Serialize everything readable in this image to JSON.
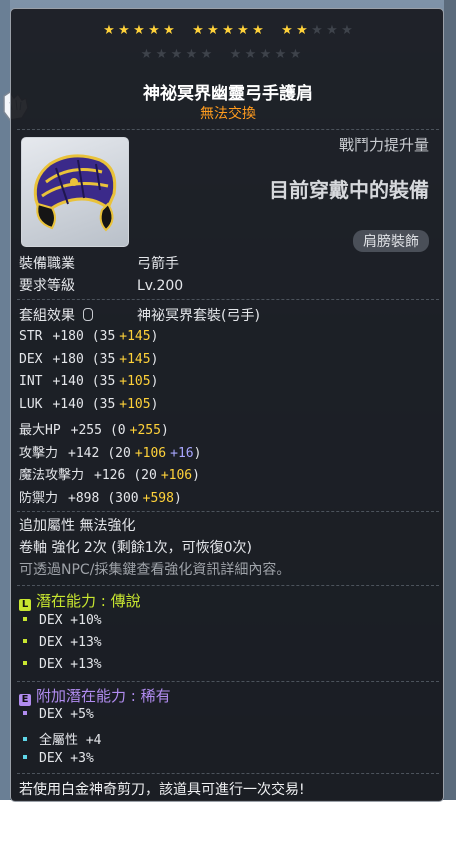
{
  "stars": {
    "filled": 12,
    "total": 15
  },
  "item": {
    "name": "神祕冥界幽靈弓手護肩",
    "trade_status": "無法交換",
    "combat_label": "戰鬥力提升量",
    "wearing_label": "目前穿戴中的裝備",
    "category_badge": "肩膀裝飾",
    "job_label": "裝備職業",
    "job_value": "弓箭手",
    "level_label": "要求等級",
    "level_value": "Lv.200",
    "set_label": "套組效果",
    "set_value": "神祕冥界套裝(弓手)"
  },
  "stats": [
    {
      "label": "STR",
      "total": "+180",
      "base": "(35",
      "bonus": "+145",
      "extra": "",
      "close": ")"
    },
    {
      "label": "DEX",
      "total": "+180",
      "base": "(35",
      "bonus": "+145",
      "extra": "",
      "close": ")"
    },
    {
      "label": "INT",
      "total": "+140",
      "base": "(35",
      "bonus": "+105",
      "extra": "",
      "close": ")"
    },
    {
      "label": "LUK",
      "total": "+140",
      "base": "(35",
      "bonus": "+105",
      "extra": "",
      "close": ")"
    },
    {
      "label": "最大HP",
      "total": "+255",
      "base": "(0",
      "bonus": "+255",
      "extra": "",
      "close": ")"
    },
    {
      "label": "攻擊力",
      "total": "+142",
      "base": "(20",
      "bonus": "+106",
      "extra": "+16",
      "close": ")"
    },
    {
      "label": "魔法攻擊力",
      "total": "+126",
      "base": "(20",
      "bonus": "+106",
      "extra": "",
      "close": ")"
    },
    {
      "label": "防禦力",
      "total": "+898",
      "base": "(300",
      "bonus": "+598",
      "extra": "",
      "close": ")"
    }
  ],
  "enhance": {
    "extra_attr": "追加屬性 無法強化",
    "scroll": "卷軸 強化 2次 (剩餘1次，可恢復0次)",
    "hint": "可透過NPC/採集鍵查看強化資訊詳細內容。"
  },
  "potential": {
    "badge": "L",
    "title": "潛在能力 : 傳說",
    "color": "#c8e630",
    "lines": [
      "DEX +10%",
      "DEX +13%",
      "DEX +13%"
    ]
  },
  "additional": {
    "badge": "E",
    "title": "附加潛在能力 : 稀有",
    "color": "#b18cf0",
    "lines": [
      "DEX +5%",
      "全屬性 +4",
      "DEX +3%"
    ],
    "bullet_colors": [
      "#b18cf0",
      "#5fd6e8",
      "#5fd6e8"
    ]
  },
  "footer_note": "若使用白金神奇剪刀，該道具可進行一次交易!"
}
